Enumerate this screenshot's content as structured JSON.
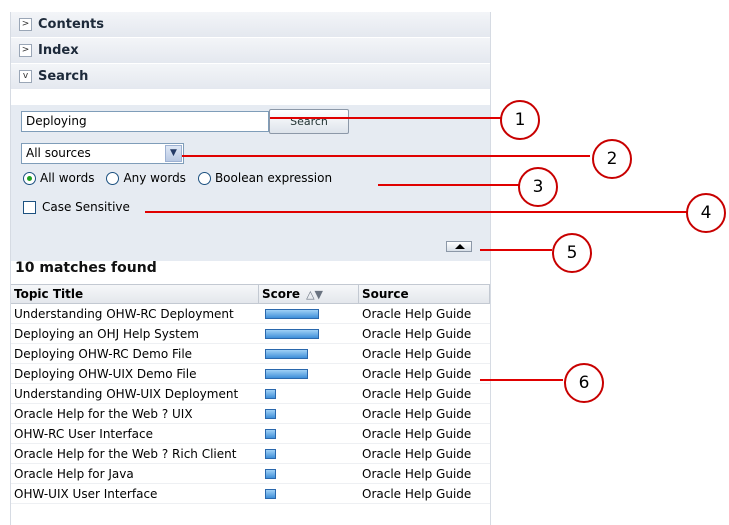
{
  "nav": {
    "contents_label": "Contents",
    "index_label": "Index",
    "search_label": "Search"
  },
  "search": {
    "query_value": "Deploying",
    "button_label": "Search",
    "source_selected": "All sources",
    "radio_all": "All words",
    "radio_any": "Any words",
    "radio_boolean": "Boolean expression",
    "selected_radio": "All words",
    "case_sensitive_label": "Case Sensitive",
    "case_sensitive_checked": false
  },
  "results": {
    "summary": "10 matches found",
    "headers": {
      "title": "Topic Title",
      "score": "Score",
      "source": "Source"
    },
    "rows": [
      {
        "title": "Understanding OHW-RC Deployment",
        "score": 1.0,
        "source": "Oracle Help Guide"
      },
      {
        "title": "Deploying an OHJ Help System",
        "score": 1.0,
        "source": "Oracle Help Guide"
      },
      {
        "title": "Deploying OHW-RC Demo File",
        "score": 0.8,
        "source": "Oracle Help Guide"
      },
      {
        "title": "Deploying OHW-UIX Demo File",
        "score": 0.8,
        "source": "Oracle Help Guide"
      },
      {
        "title": "Understanding OHW-UIX Deployment",
        "score": 0.2,
        "source": "Oracle Help Guide"
      },
      {
        "title": "Oracle Help for the Web ? UIX",
        "score": 0.2,
        "source": "Oracle Help Guide"
      },
      {
        "title": "OHW-RC User Interface",
        "score": 0.2,
        "source": "Oracle Help Guide"
      },
      {
        "title": "Oracle Help for the Web ? Rich Client",
        "score": 0.2,
        "source": "Oracle Help Guide"
      },
      {
        "title": "Oracle Help for Java",
        "score": 0.2,
        "source": "Oracle Help Guide"
      },
      {
        "title": "OHW-UIX User Interface",
        "score": 0.2,
        "source": "Oracle Help Guide"
      }
    ]
  },
  "callouts": [
    "1",
    "2",
    "3",
    "4",
    "5",
    "6"
  ],
  "colors": {
    "callout": "#e00000",
    "panel_bg": "#e6ebf2",
    "score_bar": "#3f8fd8"
  }
}
